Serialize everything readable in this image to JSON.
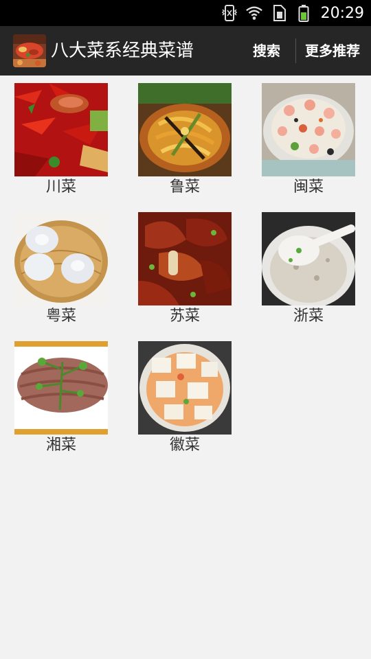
{
  "status_bar": {
    "time": "20:29",
    "icons": [
      "vibrate-icon",
      "wifi-icon",
      "sim-icon",
      "battery-icon"
    ]
  },
  "action_bar": {
    "title": "八大菜系经典菜谱",
    "search_label": "搜索",
    "more_label": "更多推荐",
    "app_icon": "food-app-icon"
  },
  "cuisines": [
    {
      "label": "川菜"
    },
    {
      "label": "鲁菜"
    },
    {
      "label": "闽菜"
    },
    {
      "label": "粤菜"
    },
    {
      "label": "苏菜"
    },
    {
      "label": "浙菜"
    },
    {
      "label": "湘菜"
    },
    {
      "label": "徽菜"
    }
  ],
  "colors": {
    "status_bg": "#000000",
    "action_bar_bg": "#262626",
    "page_bg": "#f2f2f2",
    "label_text": "#333333",
    "battery": "#6ec43a"
  }
}
